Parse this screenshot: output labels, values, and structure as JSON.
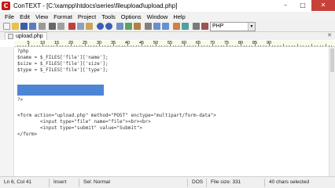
{
  "window": {
    "title": "ConTEXT - [C:\\xampp\\htdocs\\series\\fileupload\\upload.php]",
    "controls": {
      "minimize": "–",
      "maximize": "□",
      "close": "✕"
    }
  },
  "menu": {
    "items": [
      "File",
      "Edit",
      "View",
      "Format",
      "Project",
      "Tools",
      "Options",
      "Window",
      "Help"
    ]
  },
  "toolbar": {
    "language": "PHP"
  },
  "tabs": {
    "active": "upload.php"
  },
  "ruler": {
    "labels": [
      "5",
      "10",
      "15",
      "20",
      "25",
      "30",
      "35",
      "40",
      "45",
      "50",
      "55",
      "60",
      "65",
      "70",
      "75",
      "80",
      "85",
      "90"
    ]
  },
  "editor": {
    "lines": [
      "?php",
      "$name = $_FILES['file']['name'];",
      "$size = $_FILES['file']['size'];",
      "$type = $_FILES['file']['type'];",
      "",
      "",
      "",
      "?>",
      "",
      "<form action=\"upload.php\" method=\"POST\" enctype=\"multipart/form-data\">",
      "        <input type=\"file\" name=\"file\"><br><br>",
      "        <input type=\"submit\" value=\"Submit\">",
      "</form>"
    ]
  },
  "status": {
    "position": "Ln 6, Col 41",
    "mode": "Insert",
    "selection_mode": "Sel: Normal",
    "format": "DOS",
    "file_size": "File size: 331",
    "selected": "40 chars selected"
  }
}
